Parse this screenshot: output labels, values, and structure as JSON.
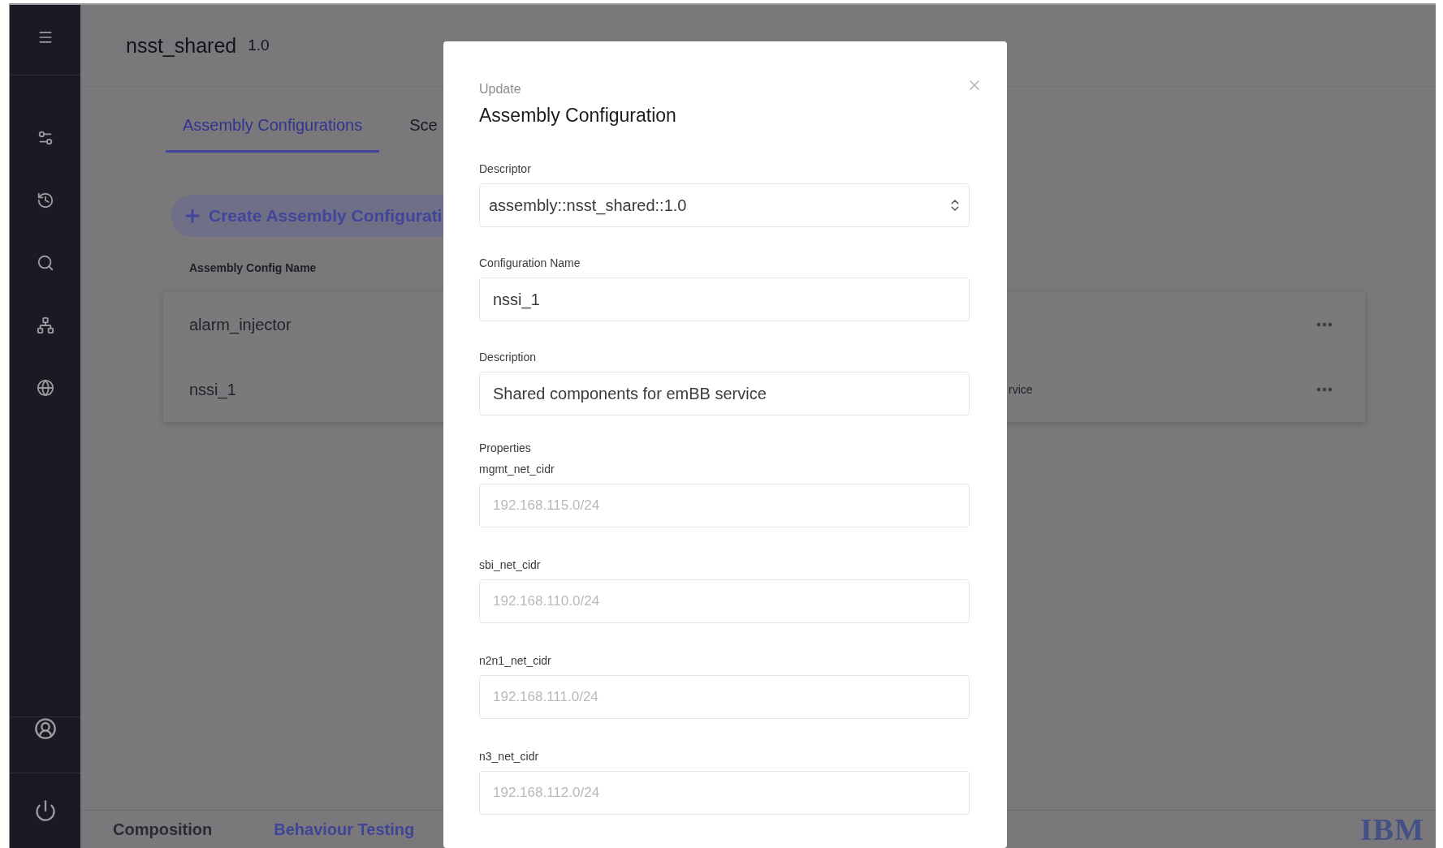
{
  "header": {
    "title": "nsst_shared",
    "version": "1.0"
  },
  "tabs": [
    {
      "label": "Assembly Configurations",
      "selected": true
    },
    {
      "label": "Sce",
      "selected": false
    }
  ],
  "create_button": {
    "label": "Create Assembly Configurati"
  },
  "table": {
    "columns": [
      "Assembly Config Name"
    ],
    "rows": [
      {
        "name": "alarm_injector"
      },
      {
        "name": "nssi_1",
        "column_2": "rvice"
      }
    ]
  },
  "bottom_tabs": [
    {
      "label": "Composition",
      "selected": false
    },
    {
      "label": "Behaviour Testing",
      "selected": true
    }
  ],
  "logo": "IBM",
  "dialog": {
    "subtitle": "Update",
    "title": "Assembly Configuration",
    "fields": [
      {
        "label": "Descriptor",
        "kind": "select",
        "value": "assembly::nsst_shared::1.0"
      },
      {
        "label": "Configuration Name",
        "kind": "text",
        "value": "nssi_1"
      },
      {
        "label": "Description",
        "kind": "text",
        "value": "Shared components for emBB service"
      }
    ],
    "properties_heading": "Properties",
    "properties": [
      {
        "label": "mgmt_net_cidr",
        "placeholder": "192.168.115.0/24"
      },
      {
        "label": "sbi_net_cidr",
        "placeholder": "192.168.110.0/24"
      },
      {
        "label": "n2n1_net_cidr",
        "placeholder": "192.168.111.0/24"
      },
      {
        "label": "n3_net_cidr",
        "placeholder": "192.168.112.0/24"
      }
    ]
  }
}
